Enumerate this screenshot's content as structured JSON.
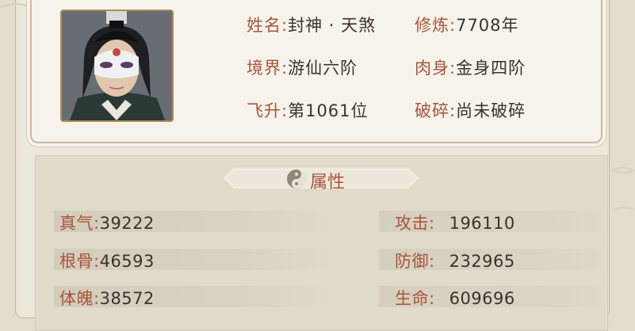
{
  "profile": {
    "name_label": "姓名:",
    "name_value": "封神 · 天煞",
    "cultivation_label": "修炼:",
    "cultivation_value": "7708年",
    "realm_label": "境界:",
    "realm_value": "游仙六阶",
    "body_label": "肉身:",
    "body_value": "金身四阶",
    "ascend_label": "飞升:",
    "ascend_value": "第1061位",
    "shatter_label": "破碎:",
    "shatter_value": "尚未破碎"
  },
  "attributes": {
    "title": "属性",
    "left": [
      {
        "label": "真气:",
        "value": "39222"
      },
      {
        "label": "根骨:",
        "value": "46593"
      },
      {
        "label": "体魄:",
        "value": "38572"
      }
    ],
    "right": [
      {
        "label": "攻击:",
        "value": "196110"
      },
      {
        "label": "防御:",
        "value": "232965"
      },
      {
        "label": "生命:",
        "value": "609696"
      }
    ]
  },
  "colors": {
    "accent": "#a8553a",
    "frame": "#b08b57"
  }
}
